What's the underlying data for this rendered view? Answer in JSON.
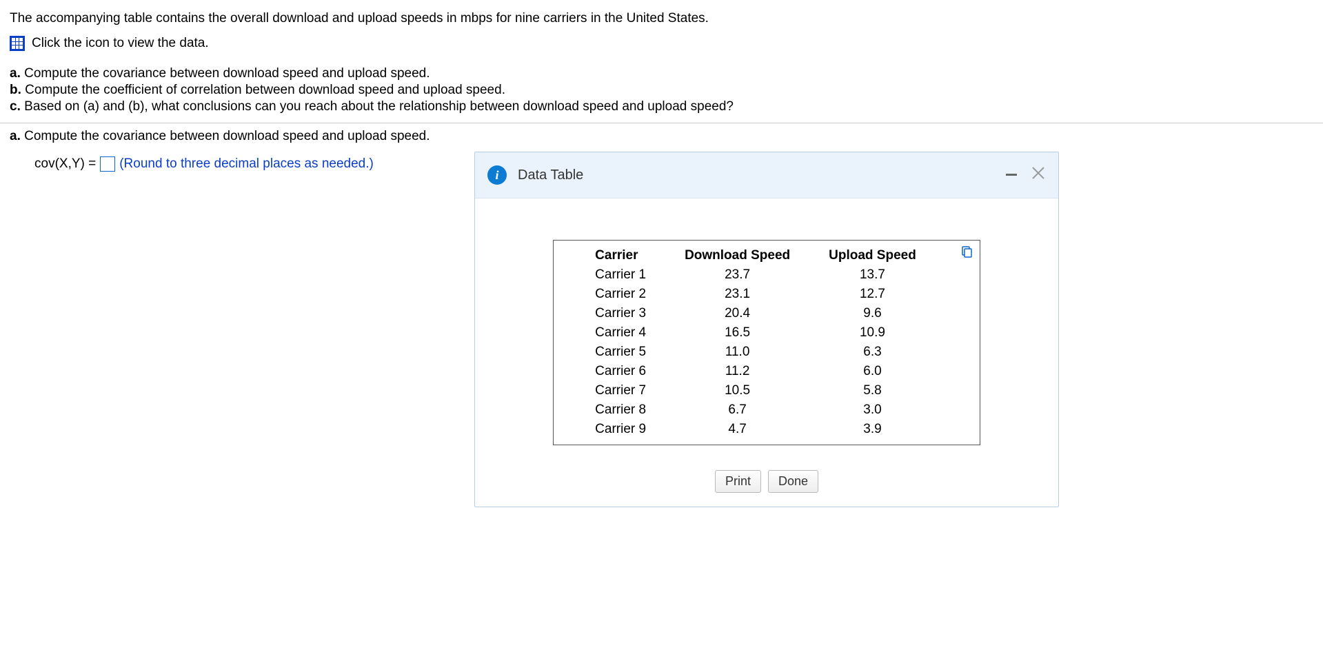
{
  "intro": "The accompanying table contains the overall download and upload speeds in mbps for nine carriers in the United States.",
  "view_link": "Click the icon to view the data.",
  "questions": {
    "a": {
      "label": "a.",
      "text": "Compute the covariance between download speed and upload speed."
    },
    "b": {
      "label": "b.",
      "text": "Compute the coefficient of correlation between download speed and upload speed."
    },
    "c": {
      "label": "c.",
      "text": "Based on (a) and (b), what conclusions can you reach about the relationship between download speed and upload speed?"
    }
  },
  "answer": {
    "prompt_label": "a.",
    "prompt_text": "Compute the covariance between download speed and upload speed.",
    "cov_lhs": "cov(X,Y) =",
    "round_hint": "(Round to three decimal places as needed.)"
  },
  "dialog": {
    "title": "Data Table",
    "print": "Print",
    "done": "Done",
    "headers": {
      "carrier": "Carrier",
      "download": "Download Speed",
      "upload": "Upload Speed"
    },
    "rows": [
      {
        "carrier": "Carrier 1",
        "download": "23.7",
        "upload": "13.7"
      },
      {
        "carrier": "Carrier 2",
        "download": "23.1",
        "upload": "12.7"
      },
      {
        "carrier": "Carrier 3",
        "download": "20.4",
        "upload": "9.6"
      },
      {
        "carrier": "Carrier 4",
        "download": "16.5",
        "upload": "10.9"
      },
      {
        "carrier": "Carrier 5",
        "download": "11.0",
        "upload": "6.3"
      },
      {
        "carrier": "Carrier 6",
        "download": "11.2",
        "upload": "6.0"
      },
      {
        "carrier": "Carrier 7",
        "download": "10.5",
        "upload": "5.8"
      },
      {
        "carrier": "Carrier 8",
        "download": "6.7",
        "upload": "3.0"
      },
      {
        "carrier": "Carrier 9",
        "download": "4.7",
        "upload": "3.9"
      }
    ]
  }
}
